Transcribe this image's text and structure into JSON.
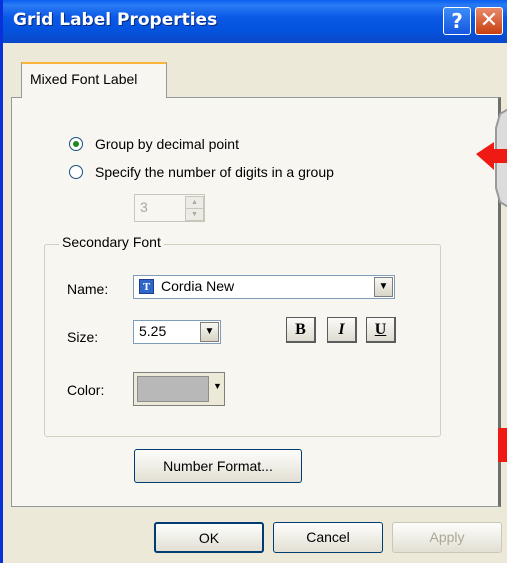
{
  "window": {
    "title": "Grid Label Properties",
    "help_label": "?",
    "close_label": "✕"
  },
  "tabs": [
    {
      "label": "Mixed Font Label",
      "selected": true
    }
  ],
  "grouping": {
    "options": [
      {
        "label": "Group by decimal point",
        "checked": true
      },
      {
        "label": "Specify the number of digits in a group",
        "checked": false
      }
    ],
    "digits_value": "3"
  },
  "secondary_font": {
    "title": "Secondary Font",
    "name_label": "Name:",
    "name_value": "Cordia New",
    "size_label": "Size:",
    "size_value": "5.25",
    "bold_label": "B",
    "italic_label": "I",
    "underline_label": "U",
    "color_label": "Color:",
    "color_value": "#b8b8b8"
  },
  "number_format_label": "Number Format...",
  "footer": {
    "ok_label": "OK",
    "cancel_label": "Cancel",
    "apply_label": "Apply"
  },
  "colors": {
    "titlebar": "#0a58e6",
    "accent_arrow": "#ef1a14"
  }
}
